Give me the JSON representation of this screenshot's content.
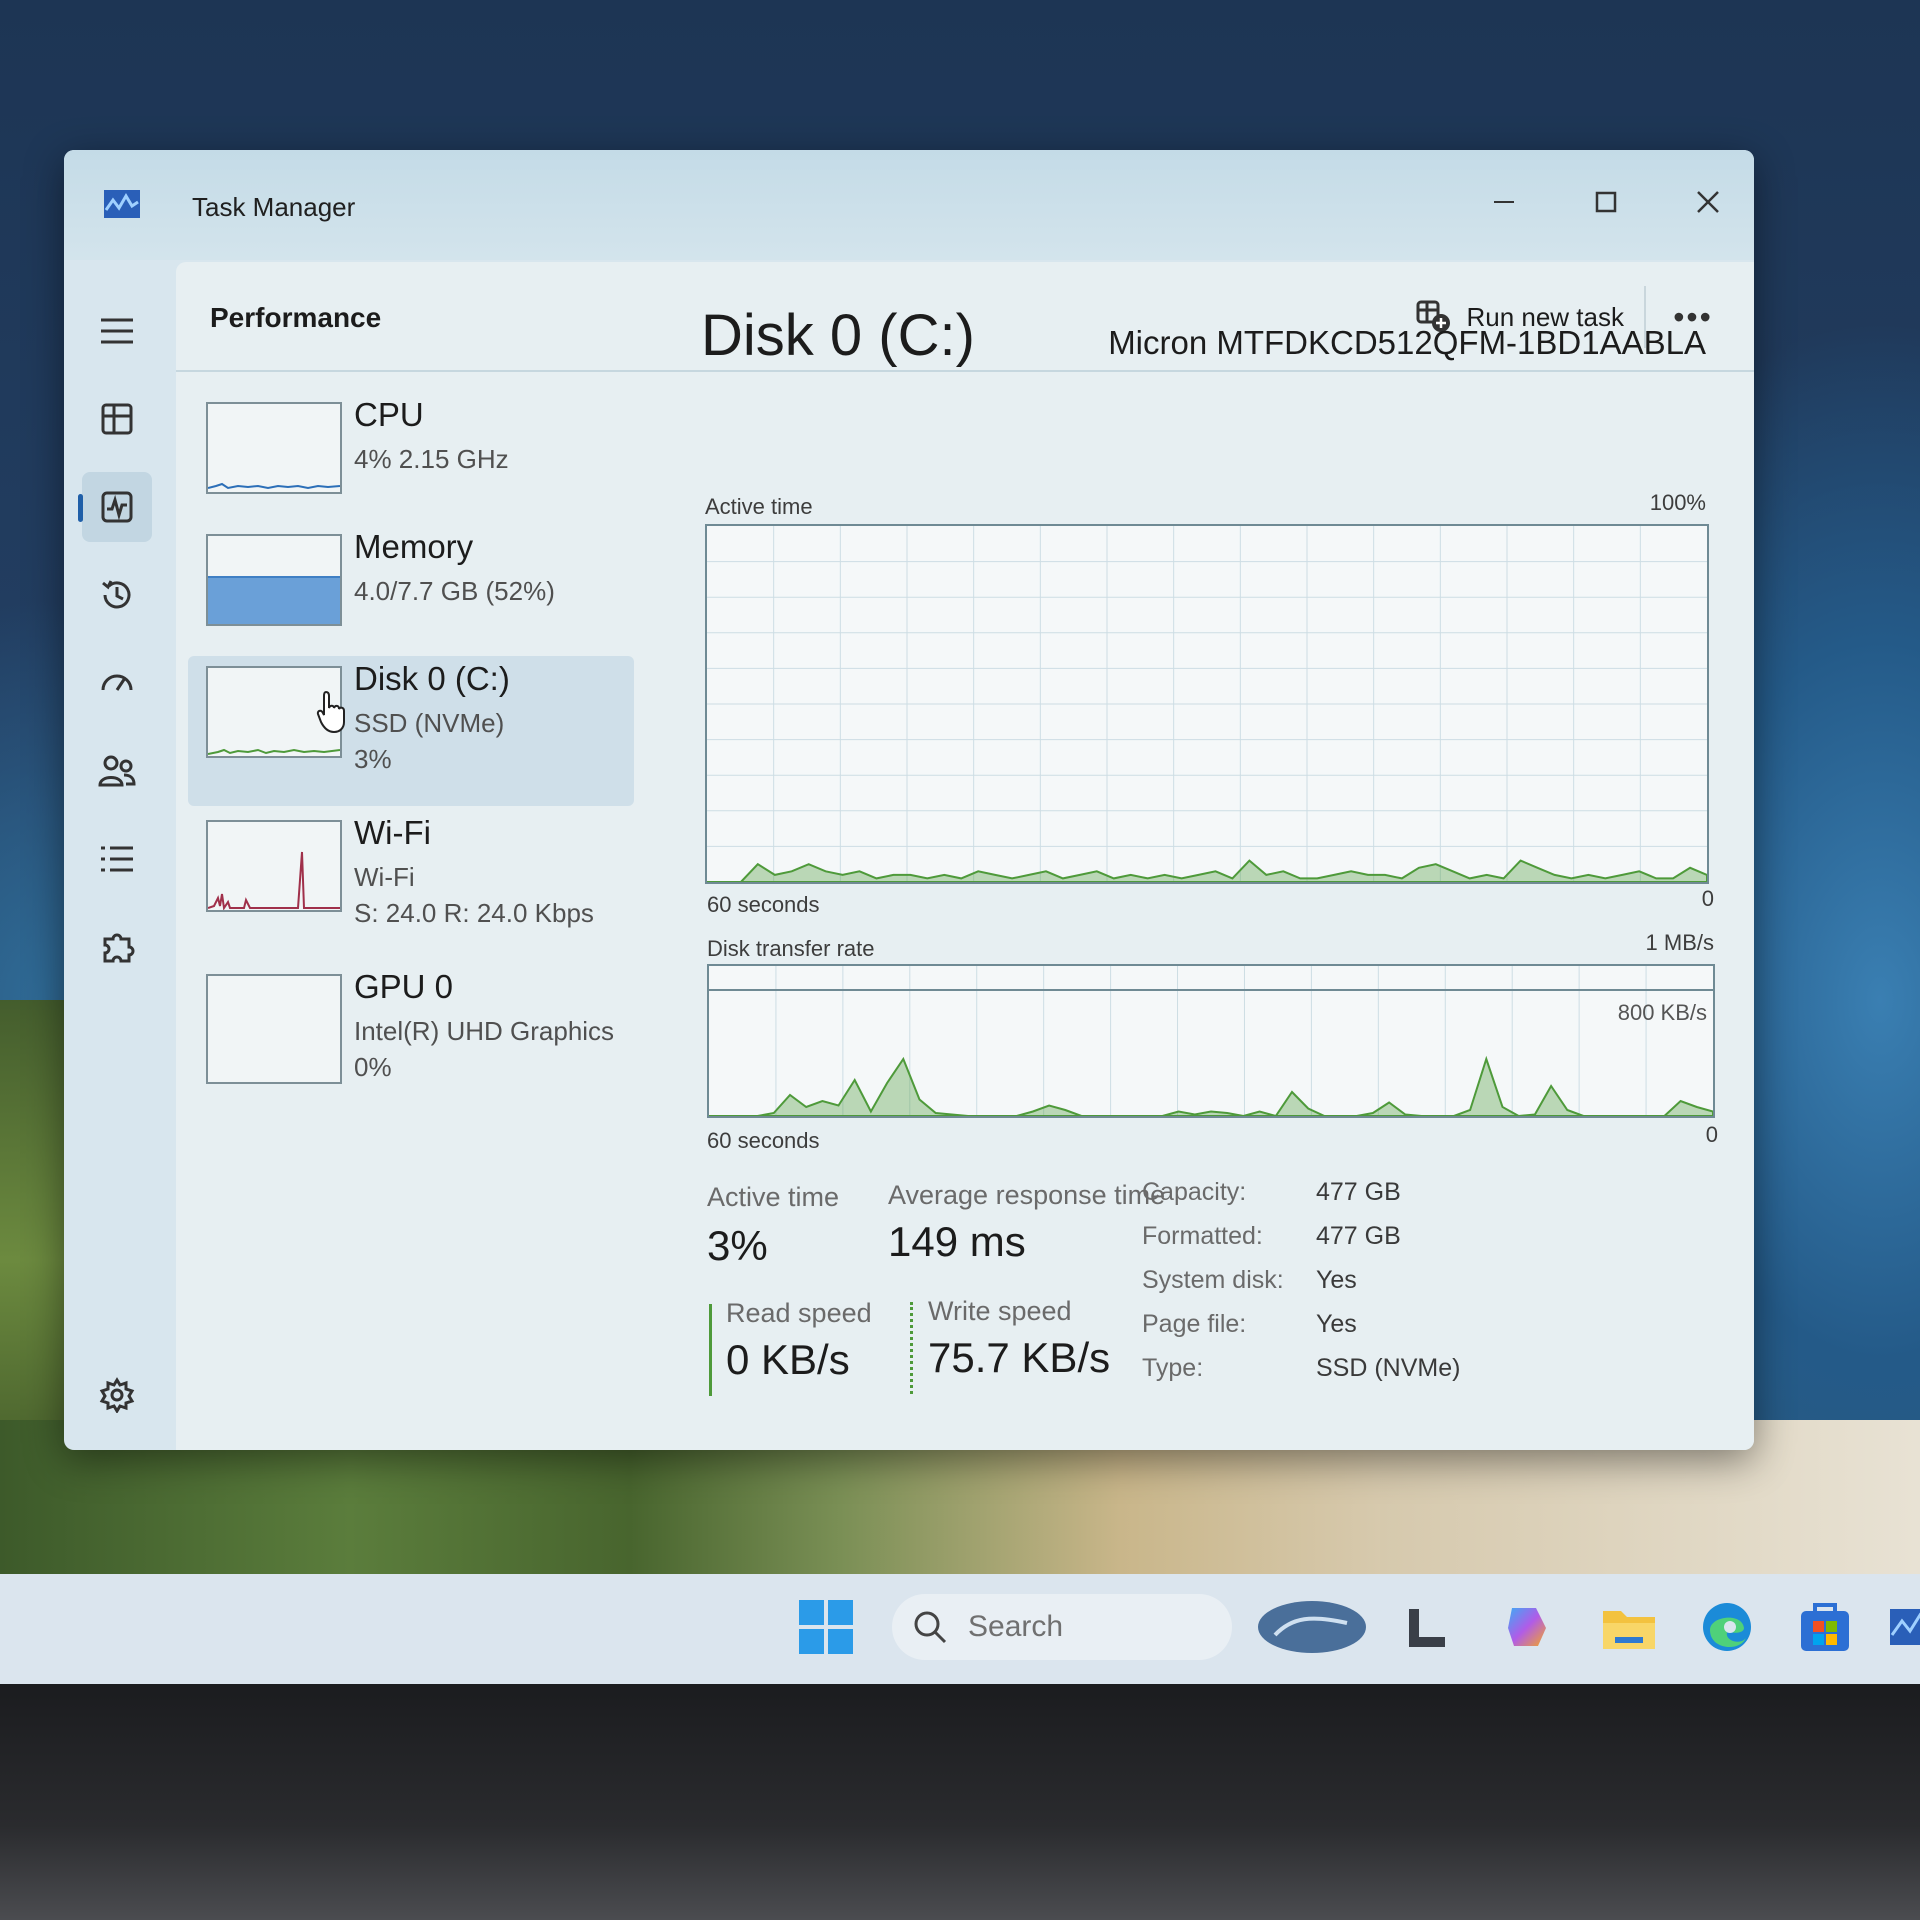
{
  "window": {
    "title": "Task Manager"
  },
  "header": {
    "title": "Performance",
    "run_new_task": "Run new task",
    "more": "•••"
  },
  "devices": [
    {
      "name": "CPU",
      "line1": "4%  2.15 GHz",
      "line2": ""
    },
    {
      "name": "Memory",
      "line1": "4.0/7.7 GB (52%)",
      "line2": ""
    },
    {
      "name": "Disk 0 (C:)",
      "line1": "SSD (NVMe)",
      "line2": "3%"
    },
    {
      "name": "Wi-Fi",
      "line1": "Wi-Fi",
      "line2": "S: 24.0  R: 24.0 Kbps"
    },
    {
      "name": "GPU 0",
      "line1": "Intel(R) UHD Graphics",
      "line2": "0%"
    }
  ],
  "detail": {
    "title": "Disk 0 (C:)",
    "model": "Micron MTFDKCD512QFM-1BD1AABLA",
    "active_graph": {
      "label": "Active time",
      "max": "100%",
      "min": "0",
      "span": "60 seconds"
    },
    "transfer_graph": {
      "label": "Disk transfer rate",
      "max": "1 MB/s",
      "mid": "800 KB/s",
      "min": "0",
      "span": "60 seconds"
    },
    "stats": {
      "active_time_label": "Active time",
      "active_time": "3%",
      "avg_resp_label": "Average response time",
      "avg_resp": "149 ms",
      "read_label": "Read speed",
      "read": "0 KB/s",
      "write_label": "Write speed",
      "write": "75.7 KB/s"
    },
    "props": [
      {
        "key": "Capacity:",
        "val": "477 GB"
      },
      {
        "key": "Formatted:",
        "val": "477 GB"
      },
      {
        "key": "System disk:",
        "val": "Yes"
      },
      {
        "key": "Page file:",
        "val": "Yes"
      },
      {
        "key": "Type:",
        "val": "SSD (NVMe)"
      }
    ]
  },
  "taskbar": {
    "search_placeholder": "Search"
  },
  "colors": {
    "accent": "#1f5fa8",
    "disk_green": "#4e9a3a",
    "memory_blue": "#6aa0d8",
    "wifi_red": "#a0304a"
  },
  "series": {
    "active_time_pct": [
      0,
      0,
      0,
      5,
      2,
      3,
      5,
      3,
      2,
      3,
      1,
      2,
      2,
      1,
      2,
      1,
      3,
      2,
      1,
      2,
      3,
      1,
      2,
      3,
      1,
      2,
      1,
      2,
      1,
      2,
      3,
      1,
      6,
      2,
      3,
      1,
      1,
      2,
      3,
      2,
      2,
      1,
      4,
      5,
      3,
      1,
      2,
      1,
      6,
      4,
      2,
      1,
      2,
      1,
      2,
      3,
      1,
      1,
      4,
      2
    ],
    "transfer_rate_kbps": [
      0,
      0,
      0,
      0,
      20,
      140,
      60,
      100,
      70,
      240,
      30,
      220,
      380,
      110,
      20,
      10,
      0,
      0,
      0,
      0,
      30,
      70,
      40,
      0,
      0,
      0,
      0,
      0,
      0,
      30,
      10,
      30,
      20,
      0,
      30,
      0,
      160,
      50,
      0,
      0,
      0,
      20,
      90,
      10,
      0,
      0,
      0,
      40,
      380,
      60,
      0,
      10,
      200,
      40,
      0,
      0,
      0,
      0,
      0,
      0,
      100,
      60,
      30
    ]
  }
}
